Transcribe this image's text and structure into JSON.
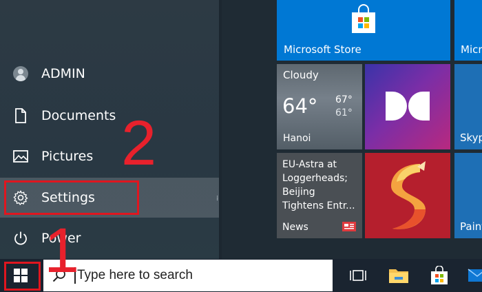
{
  "start_menu": {
    "user": {
      "label": "ADMIN"
    },
    "items": [
      {
        "label": "Documents"
      },
      {
        "label": "Pictures"
      },
      {
        "label": "Settings"
      },
      {
        "label": "Power"
      }
    ]
  },
  "annotations": {
    "step_two": "2",
    "step_one": "1"
  },
  "tiles": {
    "store": {
      "label": "Microsoft Store"
    },
    "store_partial": {
      "label": "Micr"
    },
    "weather": {
      "condition": "Cloudy",
      "temp": "64°",
      "high": "67°",
      "low": "61°",
      "city": "Hanoi"
    },
    "skype_partial": {
      "label": "Skyp"
    },
    "news": {
      "headline": "EU-Astra at Loggerheads; Beijing Tightens Entr...",
      "label": "News"
    },
    "paint_partial": {
      "label": "Paint"
    }
  },
  "taskbar": {
    "search_placeholder": "Type here to search"
  },
  "colors": {
    "accent": "#0078d4",
    "annotation_red": "#e0161f"
  }
}
